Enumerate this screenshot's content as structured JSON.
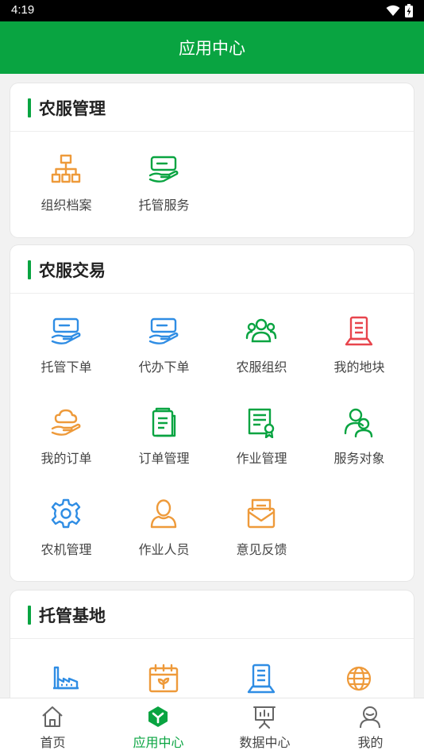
{
  "status": {
    "time": "4:19"
  },
  "header": {
    "title": "应用中心"
  },
  "sections": [
    {
      "title": "农服管理",
      "items": [
        {
          "label": "组织档案",
          "icon": "org-chart-icon",
          "color": "#ee9a3a"
        },
        {
          "label": "托管服务",
          "icon": "hand-card-icon",
          "color": "#09a441"
        }
      ]
    },
    {
      "title": "农服交易",
      "items": [
        {
          "label": "托管下单",
          "icon": "hand-card-icon",
          "color": "#2f8de4"
        },
        {
          "label": "代办下单",
          "icon": "hand-card-icon",
          "color": "#2f8de4"
        },
        {
          "label": "农服组织",
          "icon": "group-icon",
          "color": "#09a441"
        },
        {
          "label": "我的地块",
          "icon": "field-doc-icon",
          "color": "#e8454d"
        },
        {
          "label": "我的订单",
          "icon": "cloud-hand-icon",
          "color": "#ee9a3a"
        },
        {
          "label": "订单管理",
          "icon": "clipboard-icon",
          "color": "#09a441"
        },
        {
          "label": "作业管理",
          "icon": "certificate-icon",
          "color": "#09a441"
        },
        {
          "label": "服务对象",
          "icon": "users-icon",
          "color": "#09a441"
        },
        {
          "label": "农机管理",
          "icon": "gear-icon",
          "color": "#2f8de4"
        },
        {
          "label": "作业人员",
          "icon": "person-icon",
          "color": "#ee9a3a"
        },
        {
          "label": "意见反馈",
          "icon": "envelope-icon",
          "color": "#ee9a3a"
        }
      ]
    },
    {
      "title": "托管基地",
      "items": [
        {
          "label": "",
          "icon": "factory-icon",
          "color": "#2f8de4"
        },
        {
          "label": "",
          "icon": "calendar-plant-icon",
          "color": "#ee9a3a"
        },
        {
          "label": "",
          "icon": "document-stand-icon",
          "color": "#2f8de4"
        },
        {
          "label": "",
          "icon": "globe-icon",
          "color": "#ee9a3a"
        }
      ]
    }
  ],
  "tabbar": {
    "active_color": "#09a441",
    "items": [
      {
        "label": "首页",
        "icon": "home-icon"
      },
      {
        "label": "应用中心",
        "icon": "app-center-icon",
        "active": true
      },
      {
        "label": "数据中心",
        "icon": "data-board-icon"
      },
      {
        "label": "我的",
        "icon": "profile-icon"
      }
    ]
  }
}
